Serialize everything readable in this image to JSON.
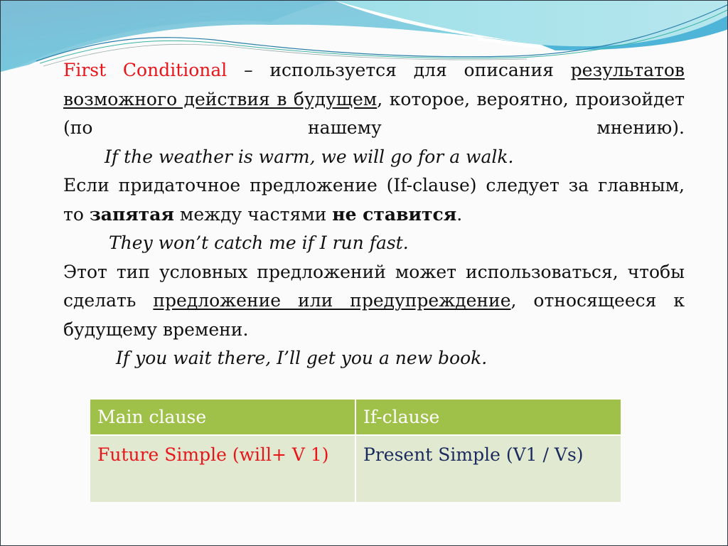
{
  "paragraph1": {
    "term": "First Conditional",
    "dash_text": " – используется для описания ",
    "underlined": "результатов возможного действия в будущем",
    "rest": ", которое, вероятно, произойдет (по нашему мнению)."
  },
  "example1": "If the weather is warm, we will go for a walk.",
  "paragraph2": {
    "part1": "Если придаточное предложение (If-clause) следует за главным, то ",
    "bold1": "запятая",
    "part2": " между частями ",
    "bold2": "не ставится",
    "part3": "."
  },
  "example2": "They won’t catch me if I run fast.",
  "paragraph3": {
    "part1": "Этот тип условных предложений может использоваться, чтобы сделать ",
    "underlined": "предложение или предупреждение",
    "part2": ", относящееся к будущему времени."
  },
  "example3": "If you wait there, I’ll get you a new book.",
  "table": {
    "headers": [
      "Main clause",
      "If-clause"
    ],
    "rows": [
      [
        "Future Simple (will+ V 1)",
        "Present Simple (V1 / Vs)"
      ]
    ]
  },
  "colors": {
    "accent_red": "#e8151b",
    "header_green": "#9fc14a",
    "cell_green": "#e1e9d0",
    "navy": "#1a2a5e"
  }
}
